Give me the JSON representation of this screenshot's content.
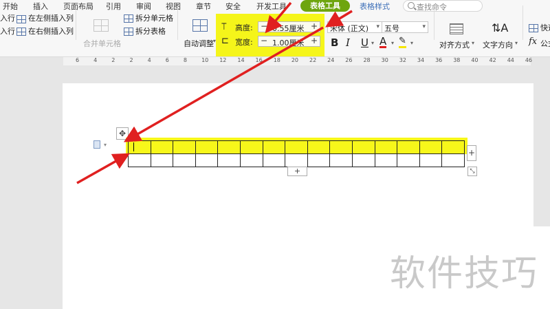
{
  "menu": {
    "items": [
      "开始",
      "插入",
      "页面布局",
      "引用",
      "审阅",
      "视图",
      "章节",
      "安全",
      "开发工具"
    ],
    "context_tab_active": "表格工具",
    "context_tab_other": "表格样式",
    "search_placeholder": "查找命令"
  },
  "ribbon": {
    "insert_row_above_partial": "入行",
    "insert_row_below_partial": "入行",
    "insert_col_left": "在左侧插入列",
    "insert_col_right": "在右侧插入列",
    "merge_cells": "合并单元格",
    "split_cells": "拆分单元格",
    "split_table": "拆分表格",
    "autofit": "自动调整",
    "height_label": "高度:",
    "height_value": "0.55厘米",
    "width_label": "宽度:",
    "width_value": "1.00厘米",
    "font_name": "宋体 (正文)",
    "font_size": "五号",
    "bold": "B",
    "italic": "I",
    "underline": "U",
    "font_color": "A",
    "align": "对齐方式",
    "text_direction": "文字方向",
    "quick_calc_partial": "快速",
    "formula_partial": "公式",
    "fx": "fx",
    "minus": "−",
    "plus": "+"
  },
  "ruler": {
    "labels": [
      "6",
      "4",
      "2",
      "2",
      "4",
      "6",
      "8",
      "10",
      "12",
      "14",
      "16",
      "18",
      "20",
      "22",
      "24",
      "26",
      "28",
      "30",
      "32",
      "34",
      "36",
      "38",
      "40",
      "42",
      "44",
      "46"
    ]
  },
  "table": {
    "rows": 2,
    "cols": 15,
    "selected_row": 1
  },
  "controls": {
    "add": "+",
    "move": "✥",
    "resize": "⤡"
  },
  "watermark": "软件技巧",
  "colors": {
    "highlight": "#f5f51a",
    "arrow": "#e02020",
    "context_tab": "#6ea50e"
  }
}
